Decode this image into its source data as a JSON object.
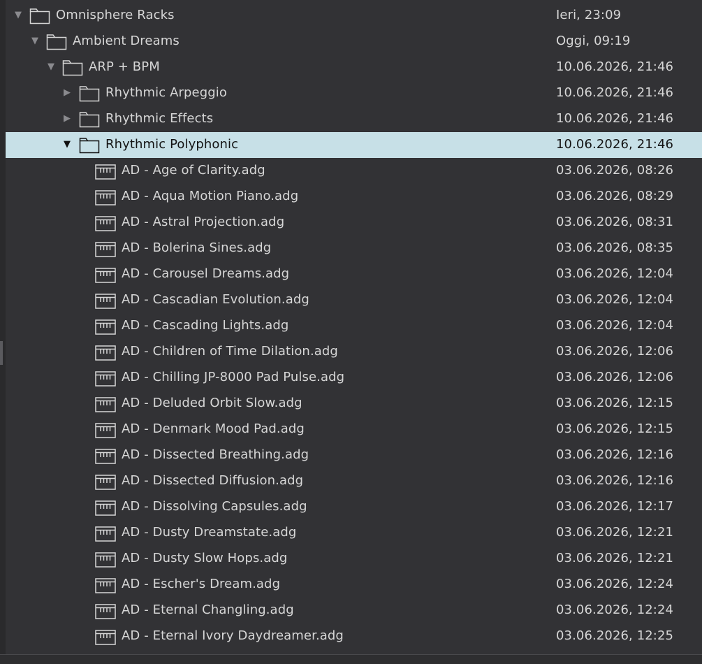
{
  "tree": {
    "folders": [
      {
        "name": "Omnisphere Racks",
        "date": "Ieri, 23:09",
        "toggle": "▼"
      },
      {
        "name": "Ambient Dreams",
        "date": "Oggi, 09:19",
        "toggle": "▼"
      },
      {
        "name": "ARP + BPM",
        "date": "10.06.2026, 21:46",
        "toggle": "▼"
      },
      {
        "name": "Rhythmic Arpeggio",
        "date": "10.06.2026, 21:46",
        "toggle": "▶"
      },
      {
        "name": "Rhythmic Effects",
        "date": "10.06.2026, 21:46",
        "toggle": "▶"
      },
      {
        "name": "Rhythmic Polyphonic",
        "date": "10.06.2026, 21:46",
        "toggle": "▼",
        "selected": true
      }
    ],
    "files": [
      {
        "name": "AD - Age of Clarity.adg",
        "date": "03.06.2026, 08:26"
      },
      {
        "name": "AD - Aqua Motion Piano.adg",
        "date": "03.06.2026, 08:29"
      },
      {
        "name": "AD - Astral Projection.adg",
        "date": "03.06.2026, 08:31"
      },
      {
        "name": "AD - Bolerina Sines.adg",
        "date": "03.06.2026, 08:35"
      },
      {
        "name": "AD - Carousel Dreams.adg",
        "date": "03.06.2026, 12:04"
      },
      {
        "name": "AD - Cascadian Evolution.adg",
        "date": "03.06.2026, 12:04"
      },
      {
        "name": "AD - Cascading Lights.adg",
        "date": "03.06.2026, 12:04"
      },
      {
        "name": "AD - Children of Time Dilation.adg",
        "date": "03.06.2026, 12:06"
      },
      {
        "name": "AD - Chilling JP-8000 Pad Pulse.adg",
        "date": "03.06.2026, 12:06"
      },
      {
        "name": "AD - Deluded Orbit Slow.adg",
        "date": "03.06.2026, 12:15"
      },
      {
        "name": "AD - Denmark Mood Pad.adg",
        "date": "03.06.2026, 12:15"
      },
      {
        "name": "AD - Dissected Breathing.adg",
        "date": "03.06.2026, 12:16"
      },
      {
        "name": "AD - Dissected Diffusion.adg",
        "date": "03.06.2026, 12:16"
      },
      {
        "name": "AD - Dissolving Capsules.adg",
        "date": "03.06.2026, 12:17"
      },
      {
        "name": "AD - Dusty Dreamstate.adg",
        "date": "03.06.2026, 12:21"
      },
      {
        "name": "AD - Dusty Slow Hops.adg",
        "date": "03.06.2026, 12:21"
      },
      {
        "name": "AD - Escher's Dream.adg",
        "date": "03.06.2026, 12:24"
      },
      {
        "name": "AD - Eternal Changling.adg",
        "date": "03.06.2026, 12:24"
      },
      {
        "name": "AD - Eternal Ivory Daydreamer.adg",
        "date": "03.06.2026, 12:25"
      }
    ]
  },
  "colors": {
    "background": "#323235",
    "selection": "#c7e0e7",
    "text": "#d6d6d6"
  },
  "icons": {
    "expanded": "chevron-down-icon",
    "collapsed": "chevron-right-icon",
    "folder": "folder-icon",
    "file": "instrument-rack-file-icon"
  }
}
